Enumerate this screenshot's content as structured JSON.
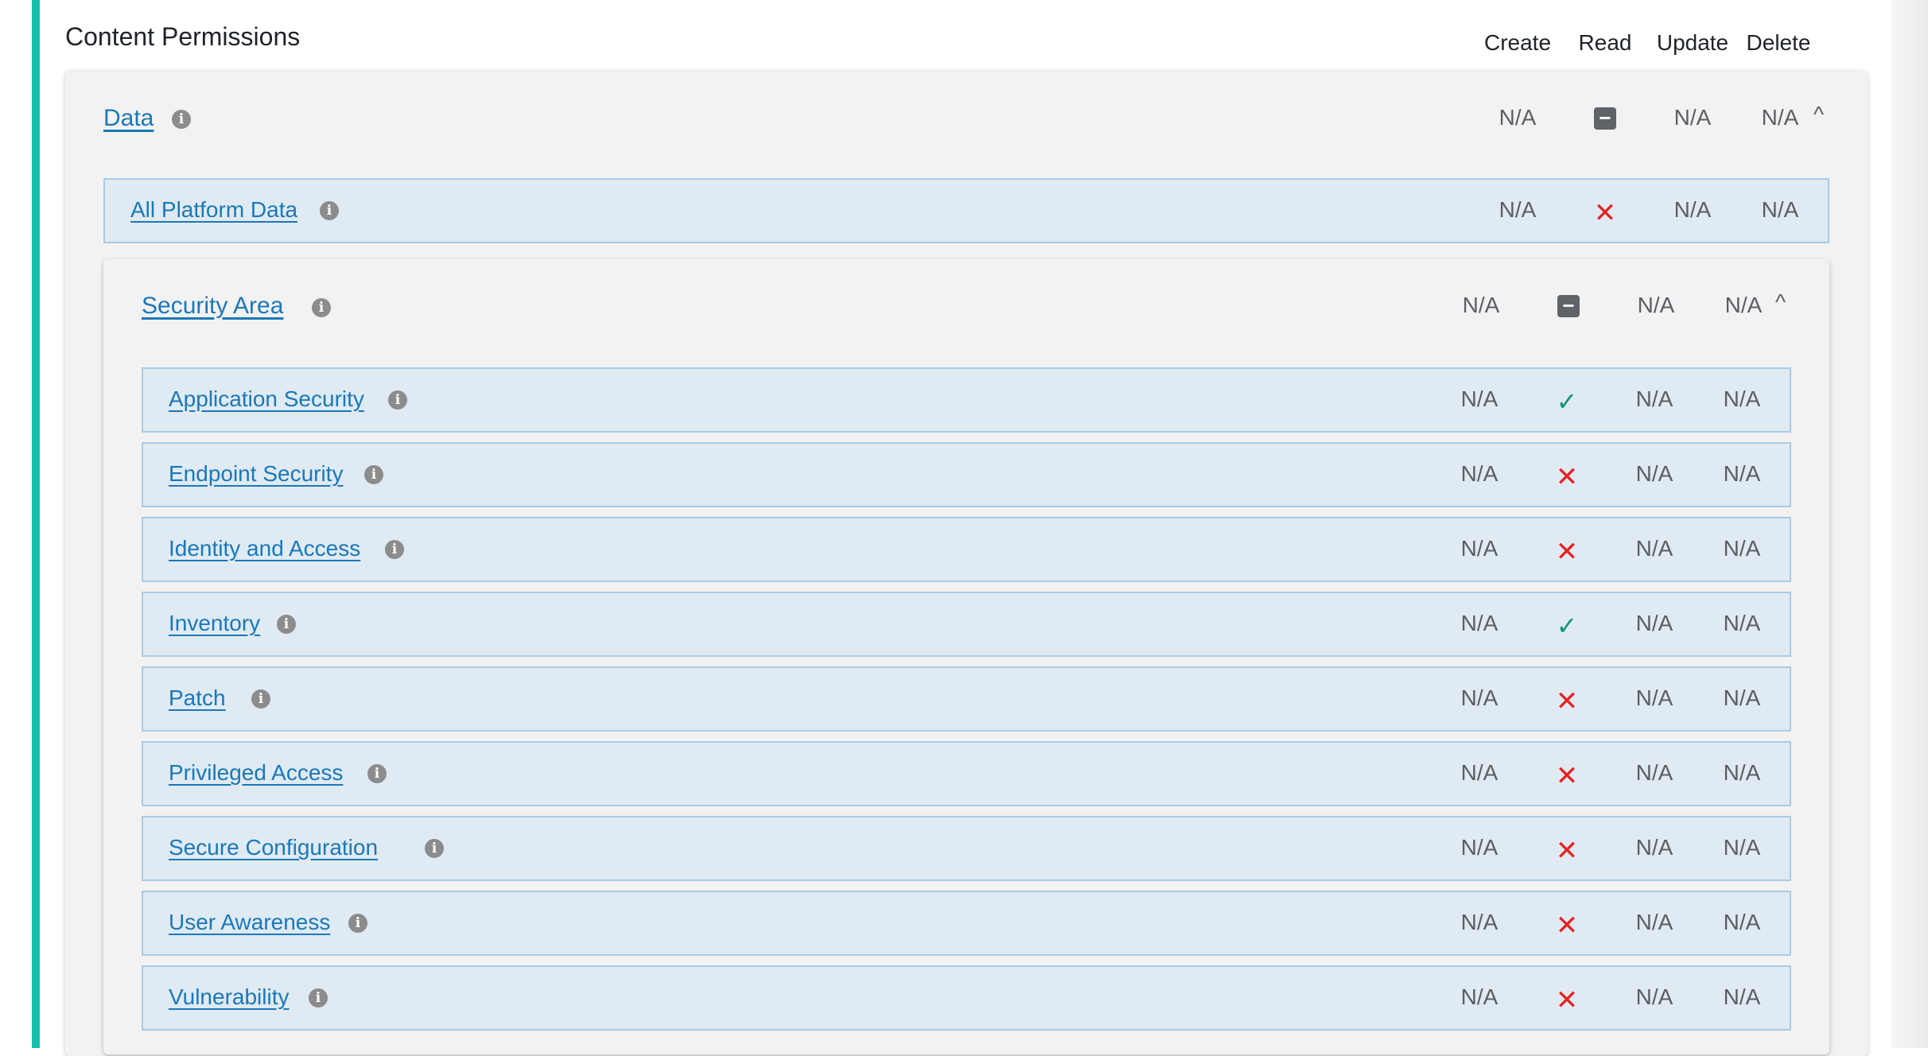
{
  "section_title": "Content Permissions",
  "columns": [
    "Create",
    "Read",
    "Update",
    "Delete"
  ],
  "icons": {
    "info": "i",
    "x": "✕",
    "check": "✓",
    "minus": "−",
    "chevron_up": "^"
  },
  "data_group": {
    "label": "Data",
    "values": [
      "N/A",
      "partial",
      "N/A",
      "N/A"
    ]
  },
  "all_platform": {
    "label": "All Platform Data",
    "values": [
      "N/A",
      "denied",
      "N/A",
      "N/A"
    ]
  },
  "security_area": {
    "label": "Security Area",
    "values": [
      "N/A",
      "partial",
      "N/A",
      "N/A"
    ],
    "items": [
      {
        "label": "Application Security",
        "values": [
          "N/A",
          "allowed",
          "N/A",
          "N/A"
        ]
      },
      {
        "label": "Endpoint Security",
        "values": [
          "N/A",
          "denied",
          "N/A",
          "N/A"
        ]
      },
      {
        "label": "Identity and Access",
        "values": [
          "N/A",
          "denied",
          "N/A",
          "N/A"
        ]
      },
      {
        "label": "Inventory",
        "values": [
          "N/A",
          "allowed",
          "N/A",
          "N/A"
        ]
      },
      {
        "label": "Patch",
        "values": [
          "N/A",
          "denied",
          "N/A",
          "N/A"
        ]
      },
      {
        "label": "Privileged Access",
        "values": [
          "N/A",
          "denied",
          "N/A",
          "N/A"
        ]
      },
      {
        "label": "Secure Configuration",
        "values": [
          "N/A",
          "denied",
          "N/A",
          "N/A"
        ]
      },
      {
        "label": "User Awareness",
        "values": [
          "N/A",
          "denied",
          "N/A",
          "N/A"
        ]
      },
      {
        "label": "Vulnerability",
        "values": [
          "N/A",
          "denied",
          "N/A",
          "N/A"
        ]
      }
    ]
  },
  "colors": {
    "accent": "#16bfae",
    "link": "#1a78b8",
    "denied": "#e02424",
    "allowed": "#15927b"
  }
}
